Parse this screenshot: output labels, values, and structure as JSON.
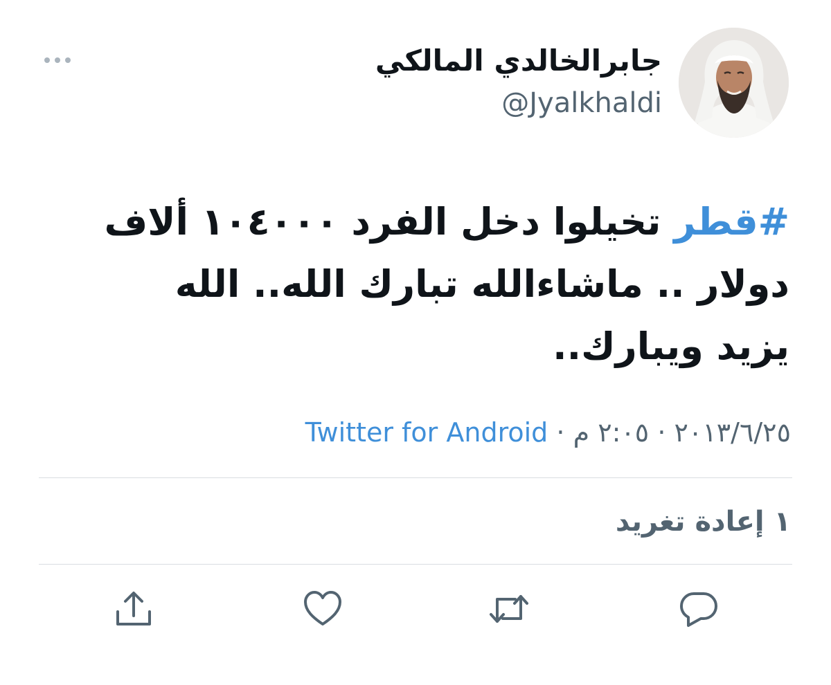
{
  "user": {
    "display_name": "جابرالخالدي المالكي",
    "handle": "@Jyalkhaldi"
  },
  "tweet": {
    "hashtag": "#قطر",
    "text": " تخيلوا دخل الفرد ١٠٤٠٠٠ ألاف دولار .. ماشاءالله تبارك الله.. الله يزيد ويبارك.."
  },
  "meta": {
    "date": "٢٠١٣/٦/٢٥",
    "separator": "·",
    "time": "٢:٠٥ م",
    "source": "Twitter for Android"
  },
  "stats": {
    "retweets_count": "١",
    "retweets_label": "إعادة تغريد"
  },
  "icons": {
    "more": "more-dots-icon",
    "reply": "reply-icon",
    "retweet": "retweet-icon",
    "like": "heart-icon",
    "share": "share-icon"
  },
  "colors": {
    "link": "#3f8fd9",
    "secondary_text": "#536471",
    "primary_text": "#0f1419",
    "divider": "#d9dde1"
  }
}
